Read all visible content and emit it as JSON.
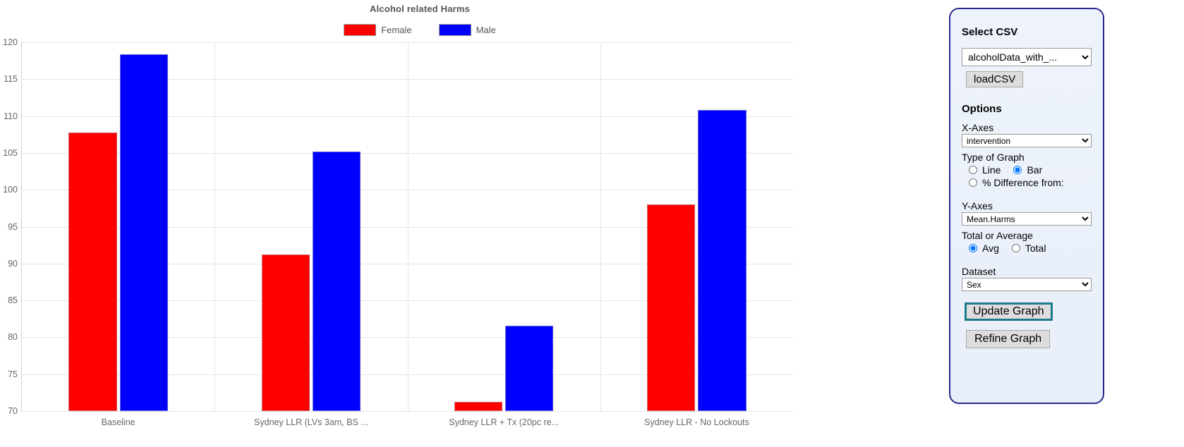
{
  "chart_data": {
    "type": "bar",
    "title": "Alcohol related Harms",
    "xlabel": "",
    "ylabel": "",
    "ylim": [
      70,
      120
    ],
    "yticks": [
      70,
      75,
      80,
      85,
      90,
      95,
      100,
      105,
      110,
      115,
      120
    ],
    "grid": true,
    "legend_position": "top-center",
    "categories": [
      "Baseline",
      "Sydney LLR (LVs 3am, BS ...",
      "Sydney LLR + Tx (20pc re...",
      "Sydney LLR - No Lockouts"
    ],
    "series": [
      {
        "name": "Female",
        "color": "#ff0000",
        "values": [
          107.8,
          91.2,
          71.2,
          98.0
        ]
      },
      {
        "name": "Male",
        "color": "#0000ff",
        "values": [
          118.4,
          105.2,
          81.6,
          110.8
        ]
      }
    ]
  },
  "panel": {
    "select_csv_heading": "Select CSV",
    "csv_value": "alcoholData_with_...",
    "csv_options": [
      "alcoholData_with_..."
    ],
    "load_csv_label": "loadCSV",
    "options_heading": "Options",
    "x_axes_label": "X-Axes",
    "x_axes_value": "intervention",
    "x_axes_options": [
      "intervention"
    ],
    "type_of_graph_label": "Type of Graph",
    "graph_type_line": "Line",
    "graph_type_bar": "Bar",
    "graph_type_pct_diff": "% Difference from:",
    "graph_type_selected": "Bar",
    "y_axes_label": "Y-Axes",
    "y_axes_value": "Mean.Harms",
    "y_axes_options": [
      "Mean.Harms"
    ],
    "total_or_average_label": "Total or Average",
    "avg_label": "Avg",
    "total_label": "Total",
    "agg_selected": "Avg",
    "dataset_label": "Dataset",
    "dataset_value": "Sex",
    "dataset_options": [
      "Sex"
    ],
    "update_graph_label": "Update Graph",
    "refine_graph_label": "Refine Graph",
    "border_color": "#2b2b8f",
    "primary_button_outline": "#1d7a8c"
  }
}
